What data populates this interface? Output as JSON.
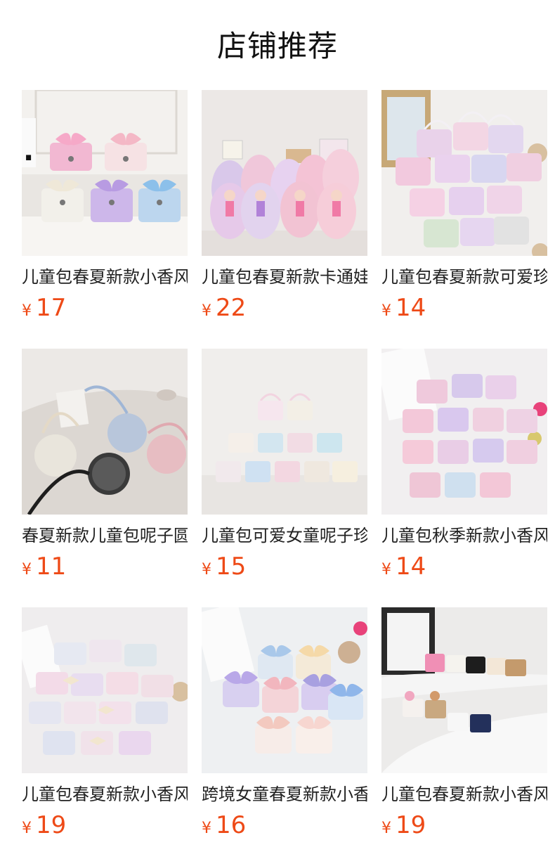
{
  "header": {
    "title": "店铺推荐"
  },
  "currency_symbol": "¥",
  "products": [
    {
      "name": "儿童包春夏新款小香风蝴蝶结斜挎包",
      "price": "17",
      "image": "pastel-bow-bags-photo"
    },
    {
      "name": "儿童包春夏新款卡通娃娃双肩包",
      "price": "22",
      "image": "doll-backpacks-photo"
    },
    {
      "name": "儿童包春夏新款可爱珍珠手提包",
      "price": "14",
      "image": "pearl-handbags-photo"
    },
    {
      "name": "春夏新款儿童包呢子圆形斜挎包",
      "price": "11",
      "image": "round-tweed-bags-photo"
    },
    {
      "name": "儿童包可爱女童呢子珍珠手提包",
      "price": "15",
      "image": "pearl-bow-handbags-photo"
    },
    {
      "name": "儿童包秋季新款小香风手提包",
      "price": "14",
      "image": "pink-tweed-handbags-photo"
    },
    {
      "name": "儿童包春夏新款小香风珍珠手提包",
      "price": "19",
      "image": "pearl-tweed-handbags-photo"
    },
    {
      "name": "跨境女童春夏新款小香风蝴蝶结包",
      "price": "16",
      "image": "bow-tweed-bags-photo"
    },
    {
      "name": "儿童包春夏新款小香风毛绒包",
      "price": "19",
      "image": "plush-bags-photo"
    }
  ]
}
